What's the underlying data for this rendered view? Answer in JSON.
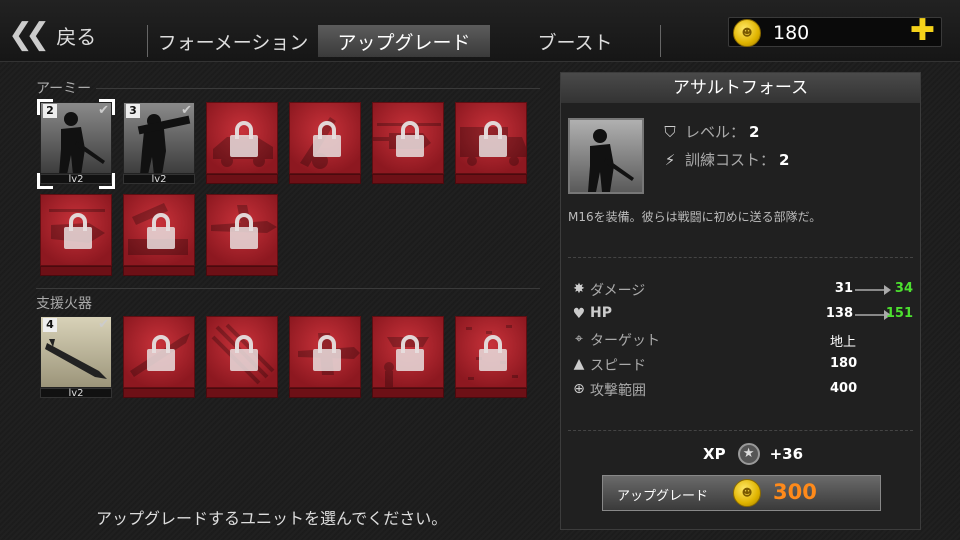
{
  "header": {
    "back_label": "戻る",
    "tabs": [
      {
        "label": "フォーメーション",
        "active": false
      },
      {
        "label": "アップグレード",
        "active": true
      },
      {
        "label": "ブースト",
        "active": false
      }
    ],
    "coins": "180"
  },
  "army": {
    "label": "アーミー",
    "units": [
      {
        "icon": "rifleman-icon",
        "locked": false,
        "selected": true,
        "count": "2",
        "level": "lv2"
      },
      {
        "icon": "bazooka-soldier-icon",
        "locked": false,
        "selected": false,
        "count": "3",
        "level": "lv2"
      },
      {
        "icon": "jeep-icon",
        "locked": true
      },
      {
        "icon": "artillery-icon",
        "locked": true
      },
      {
        "icon": "helicopter-icon",
        "locked": true
      },
      {
        "icon": "truck-icon",
        "locked": true
      },
      {
        "icon": "attack-helicopter-icon",
        "locked": true
      },
      {
        "icon": "rocket-launcher-icon",
        "locked": true
      },
      {
        "icon": "fighter-plane-icon",
        "locked": true
      }
    ]
  },
  "support": {
    "label": "支援火器",
    "units": [
      {
        "icon": "missile-icon",
        "locked": false,
        "selected": false,
        "count": "4",
        "level": "lv2"
      },
      {
        "icon": "guided-missile-icon",
        "locked": true
      },
      {
        "icon": "airstrike-icon",
        "locked": true
      },
      {
        "icon": "bomber-icon",
        "locked": true
      },
      {
        "icon": "paratrooper-icon",
        "locked": true
      },
      {
        "icon": "bombardment-icon",
        "locked": true
      }
    ]
  },
  "hint": "アップグレードするユニットを選んでください。",
  "detail": {
    "title": "アサルトフォース",
    "portrait_icon": "rifleman-icon",
    "level_label": "レベル：",
    "level_value": "2",
    "cost_label": "訓練コスト：",
    "cost_value": "2",
    "description": "M16を装備。彼らは戦闘に初めに送る部隊だ。",
    "stats": {
      "damage": {
        "label": "ダメージ",
        "current": "31",
        "next": "34"
      },
      "hp": {
        "label": "HP",
        "current": "138",
        "next": "151"
      },
      "target": {
        "label": "ターゲット",
        "value": "地上"
      },
      "speed": {
        "label": "スピード",
        "value": "180"
      },
      "range": {
        "label": "攻撃範囲",
        "value": "400"
      }
    },
    "xp_label": "XP",
    "xp_value": "+36",
    "upgrade_label": "アップグレード",
    "upgrade_cost": "300"
  },
  "colors": {
    "locked_tile": "#a8222a",
    "upgrade_cost": "#ff8a1a",
    "stat_increase": "#4ce02f",
    "coin": "#f4d21a"
  }
}
